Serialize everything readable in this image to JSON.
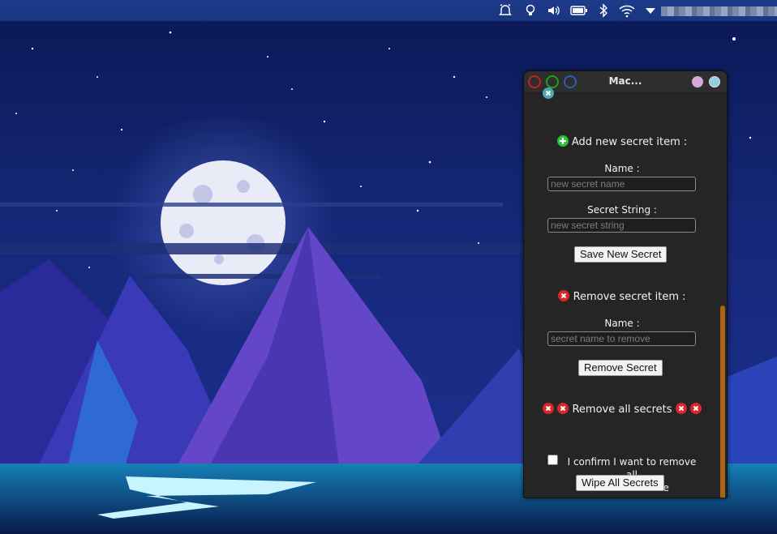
{
  "window": {
    "title": "Mac..."
  },
  "add_section": {
    "heading": "Add new secret item :",
    "name_label": "Name :",
    "name_placeholder": "new secret name",
    "secret_label": "Secret String :",
    "secret_placeholder": "new secret string",
    "save_button": "Save New Secret"
  },
  "remove_section": {
    "heading": "Remove secret item :",
    "name_label": "Name :",
    "name_placeholder": "secret name to remove",
    "remove_button": "Remove Secret"
  },
  "remove_all_section": {
    "heading": "Remove all secrets",
    "confirm_line1": "I confirm I want to remove all",
    "confirm_line2": "secrets at once",
    "confirm_checked": false,
    "wipe_button": "Wipe All Secrets"
  },
  "colors": {
    "add_icon": "#2bbf3a",
    "remove_icon": "#d9262b",
    "scrollbar": "#a8631a",
    "close_ring": "#c81e1e",
    "minimize_ring": "#20a020",
    "maximize_ring": "#2a5fb8"
  },
  "icons": {
    "tray": [
      "alarm-icon",
      "lightbulb-icon",
      "volume-icon",
      "battery-icon",
      "bluetooth-icon",
      "wifi-icon",
      "dropdown-arrow-icon"
    ]
  }
}
